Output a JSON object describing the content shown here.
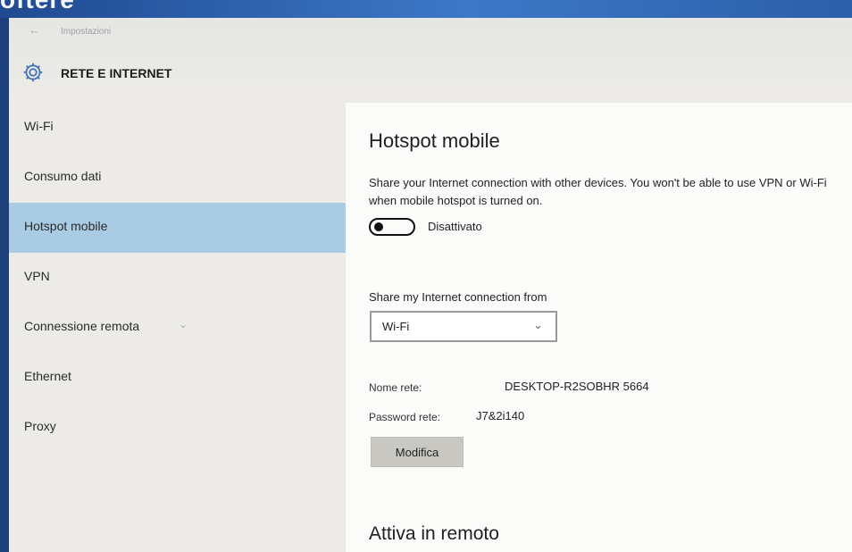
{
  "banner": {
    "text": "oftere"
  },
  "header": {
    "back_icon": "back-arrow-icon",
    "breadcrumb": "Impostazioni",
    "section_icon": "gear-icon",
    "section_title": "RETE E INTERNET",
    "accent_color": "#3f6fb5"
  },
  "sidebar": {
    "active_color": "#a9cbe3",
    "items": [
      {
        "label": "Wi-Fi"
      },
      {
        "label": "Consumo dati"
      },
      {
        "label": "Hotspot mobile",
        "active": true
      },
      {
        "label": "VPN"
      },
      {
        "label": "Connessione remota",
        "icon": "chevron-down-icon"
      },
      {
        "label": "Ethernet"
      },
      {
        "label": "Proxy"
      }
    ]
  },
  "main": {
    "title": "Hotspot mobile",
    "description": "Share your Internet connection with other devices. You won't be able to use VPN or Wi-Fi when mobile hotspot is turned on.",
    "toggle": {
      "state": "off",
      "label": "Disattivato"
    },
    "share_from": {
      "label": "Share my Internet connection from",
      "selected": "Wi-Fi"
    },
    "network_name": {
      "label": "Nome rete:",
      "value": "DESKTOP-R2SOBHR 5664"
    },
    "network_password": {
      "label": "Password rete:",
      "value": "J7&2i140"
    },
    "modify_button": "Modifica",
    "remote_title": "Attiva in remoto"
  }
}
